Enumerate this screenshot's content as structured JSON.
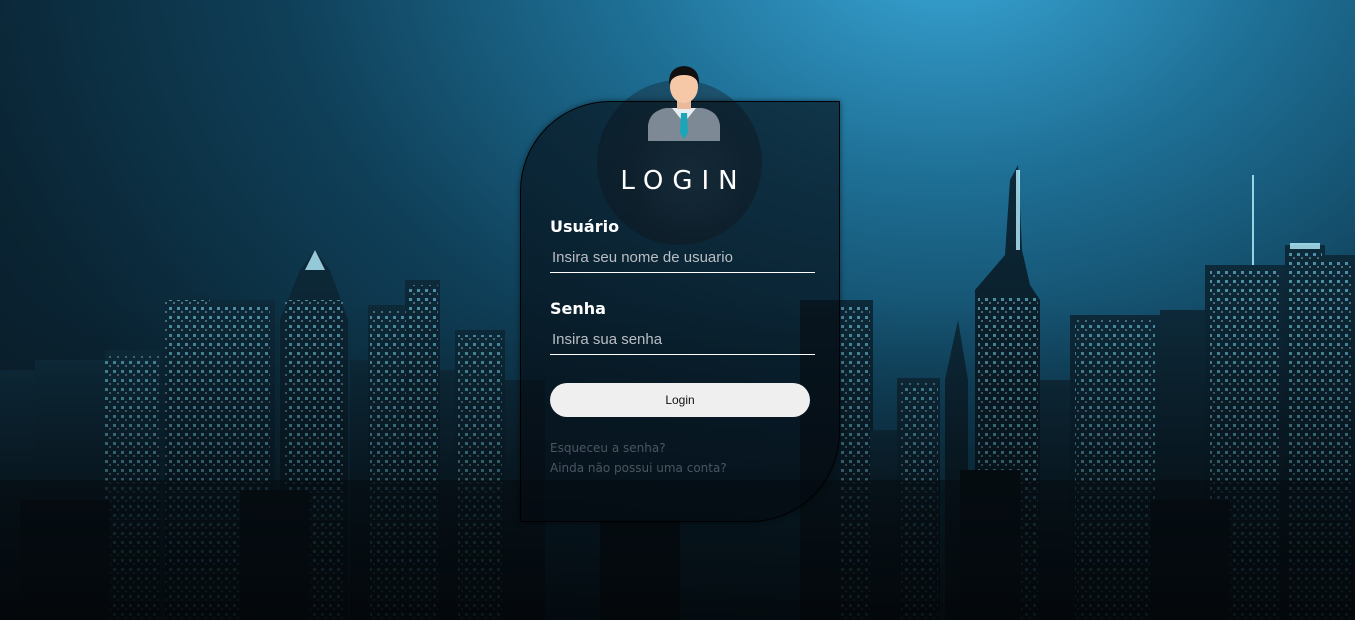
{
  "login": {
    "title": "LOGIN",
    "username_label": "Usuário",
    "username_placeholder": "Insira seu nome de usuario",
    "username_value": "",
    "password_label": "Senha",
    "password_placeholder": "Insira sua senha",
    "password_value": "",
    "submit_label": "Login",
    "forgot_link": "Esqueceu a senha?",
    "signup_link": "Ainda não possui uma conta?"
  },
  "icons": {
    "avatar": "businessman-avatar-icon",
    "background": "night-city-skyline"
  },
  "colors": {
    "accent_sky": "#3aa8d8",
    "card_bg": "#0a1016",
    "button_bg": "#efefef",
    "tie": "#1aa6b8"
  }
}
